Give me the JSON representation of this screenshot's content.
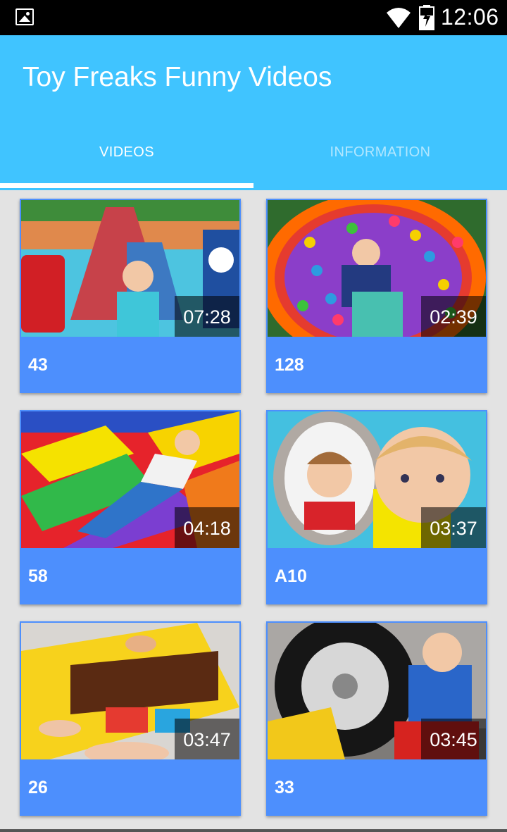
{
  "status_bar": {
    "time": "12:06"
  },
  "app_bar": {
    "title": "Toy Freaks Funny Videos"
  },
  "tabs": [
    {
      "label": "VIDEOS",
      "selected": true
    },
    {
      "label": "INFORMATION",
      "selected": false
    }
  ],
  "videos": [
    {
      "title": "43",
      "duration": "07:28"
    },
    {
      "title": "128",
      "duration": "02:39"
    },
    {
      "title": "58",
      "duration": "04:18"
    },
    {
      "title": "A10",
      "duration": "03:37"
    },
    {
      "title": "26",
      "duration": "03:47"
    },
    {
      "title": "33",
      "duration": "03:45"
    }
  ],
  "colors": {
    "app_bar": "#40c4ff",
    "card": "#4d8ffd",
    "background": "#e3e3e3"
  }
}
